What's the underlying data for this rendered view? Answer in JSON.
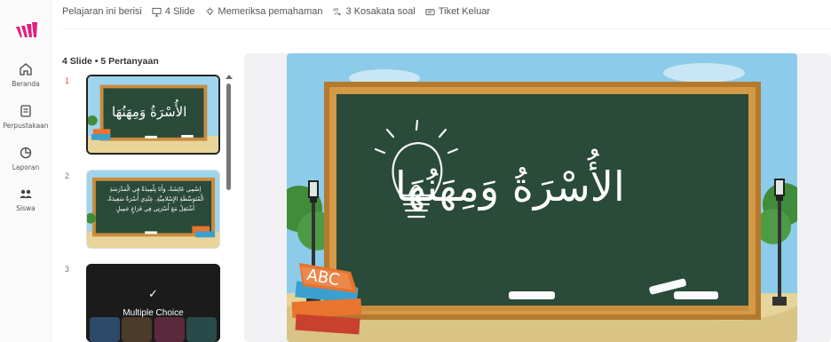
{
  "lesson_info": {
    "intro": "Pelajaran ini berisi",
    "slides": "4 Slide",
    "check": "Memeriksa pemahaman",
    "vocab": "3 Kosakata soal",
    "exit": "Tiket Keluar"
  },
  "nav": [
    {
      "label": "Beranda",
      "icon": "home-icon"
    },
    {
      "label": "Perpustakaan",
      "icon": "library-icon"
    },
    {
      "label": "Laporan",
      "icon": "reports-icon"
    },
    {
      "label": "Siswa",
      "icon": "students-icon"
    }
  ],
  "panel": {
    "count": "4 Slide • 5 Pertanyaan",
    "slides": [
      {
        "number": "1",
        "title": "الأُسْرَةُ وَمِهَنُهَا"
      },
      {
        "number": "2",
        "text": "اِسْمِي عَائِشَةُ، وَأَنَا تِلْمِيذَةٌ فِي الْمَدْرَسَةِ الْمُتَوَسِّطَةِ الإِسْلامِيَّةِ. عِنْدِي أُسْرَةٌ سَعِيدَةٌ، أَشْتَغِلُ مَعَ أُسْرَتِي فِي فَرَاغٍ جَمِيلٍ"
      },
      {
        "number": "3",
        "check": "✓",
        "label": "Multiple Choice"
      }
    ]
  },
  "main_slide": {
    "title": "الأُسْرَةُ وَمِهَنُهَا",
    "book_text": "ABC"
  },
  "colors": {
    "brand": "#e0217a",
    "board": "#2a4a3a",
    "frame": "#d49a45",
    "sky": "#8ccbe9",
    "active_number": "#e24a4a"
  }
}
